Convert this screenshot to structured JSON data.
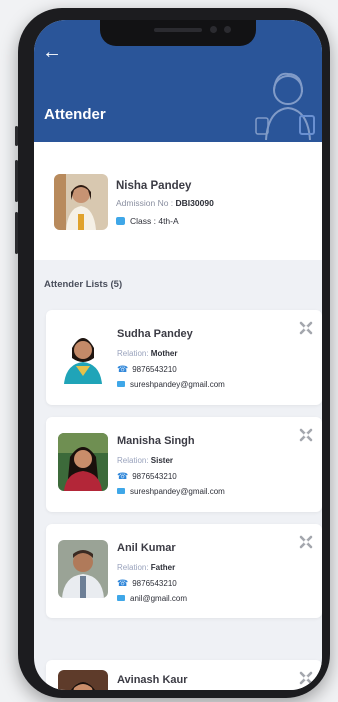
{
  "header": {
    "title": "Attender",
    "back_icon": "arrow-left-icon"
  },
  "student": {
    "name": "Nisha Pandey",
    "admission_label": "Admission No : ",
    "admission_no": "DBI30090",
    "class_label": "Class : 4th-A"
  },
  "attenders": {
    "title": "Attender Lists (5)",
    "items": [
      {
        "name": "Sudha Pandey",
        "relation_label": "Relation: ",
        "relation": "Mother",
        "phone": "9876543210",
        "email": "sureshpandey@gmail.com"
      },
      {
        "name": "Manisha Singh",
        "relation_label": "Relation: ",
        "relation": "Sister",
        "phone": "9876543210",
        "email": "sureshpandey@gmail.com"
      },
      {
        "name": "Anil Kumar",
        "relation_label": "Relation: ",
        "relation": "Father",
        "phone": "9876543210",
        "email": "anil@gmail.com"
      },
      {
        "name": "Avinash Kaur"
      }
    ]
  },
  "colors": {
    "header": "#2a5599",
    "accent": "#3fa7e8",
    "background": "#eff1f5"
  }
}
